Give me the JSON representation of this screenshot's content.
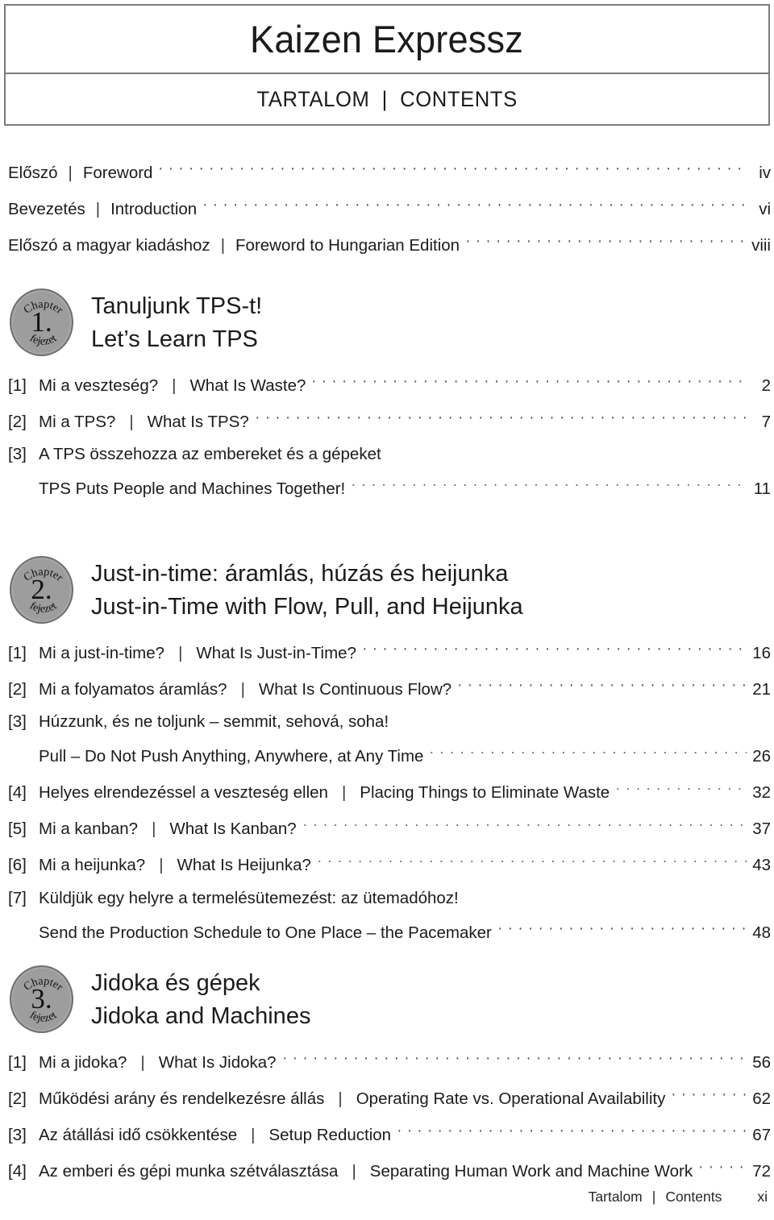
{
  "header": {
    "title": "Kaizen Expressz",
    "subtitle_hu": "TARTALOM",
    "subtitle_sep": "|",
    "subtitle_en": "CONTENTS"
  },
  "front_matter": [
    {
      "label_hu": "Előszó",
      "sep": "|",
      "label_en": "Foreword",
      "page": "iv"
    },
    {
      "label_hu": "Bevezetés",
      "sep": "|",
      "label_en": "Introduction",
      "page": "vi"
    },
    {
      "label_hu": "Előszó a magyar kiadáshoz",
      "sep": "|",
      "label_en": "Foreword to Hungarian Edition",
      "page": "viii"
    }
  ],
  "chapters": [
    {
      "badge": {
        "top_text": "Chapter",
        "number": "1.",
        "bottom_text": "fejezet"
      },
      "title_hu": "Tanuljunk TPS-t!",
      "title_en": "Let’s Learn TPS",
      "entries": [
        {
          "num": "[1]",
          "hu": "Mi a veszteség?",
          "sep": "|",
          "en": "What Is Waste?",
          "page": "2",
          "two_line": false
        },
        {
          "num": "[2]",
          "hu": "Mi a TPS?",
          "sep": "|",
          "en": "What Is TPS?",
          "page": "7",
          "two_line": false
        },
        {
          "num": "[3]",
          "hu": "A TPS összehozza az embereket és a gépeket",
          "sep": "",
          "en": "TPS Puts People and Machines Together!",
          "page": "11",
          "two_line": true
        }
      ]
    },
    {
      "badge": {
        "top_text": "Chapter",
        "number": "2.",
        "bottom_text": "fejezet"
      },
      "title_hu": "Just-in-time: áramlás, húzás és heijunka",
      "title_en": "Just-in-Time with Flow, Pull, and Heijunka",
      "entries": [
        {
          "num": "[1]",
          "hu": "Mi a just-in-time?",
          "sep": "|",
          "en": "What Is Just-in-Time?",
          "page": "16",
          "two_line": false
        },
        {
          "num": "[2]",
          "hu": "Mi a folyamatos áramlás?",
          "sep": "|",
          "en": "What Is Continuous Flow?",
          "page": "21",
          "two_line": false
        },
        {
          "num": "[3]",
          "hu": "Húzzunk, és ne toljunk – semmit, sehová, soha!",
          "sep": "",
          "en": "Pull – Do Not Push Anything, Anywhere, at Any Time",
          "page": "26",
          "two_line": true
        },
        {
          "num": "[4]",
          "hu": "Helyes elrendezéssel a veszteség ellen",
          "sep": "|",
          "en": "Placing Things to Eliminate Waste",
          "page": "32",
          "two_line": false
        },
        {
          "num": "[5]",
          "hu": "Mi a kanban?",
          "sep": "|",
          "en": "What Is Kanban?",
          "page": "37",
          "two_line": false
        },
        {
          "num": "[6]",
          "hu": "Mi a heijunka?",
          "sep": "|",
          "en": "What Is Heijunka?",
          "page": "43",
          "two_line": false
        },
        {
          "num": "[7]",
          "hu": "Küldjük egy helyre a termelésütemezést: az ütemadóhoz!",
          "sep": "",
          "en": "Send the Production Schedule to One Place – the Pacemaker",
          "page": "48",
          "two_line": true
        }
      ]
    },
    {
      "badge": {
        "top_text": "Chapter",
        "number": "3.",
        "bottom_text": "fejezet"
      },
      "title_hu": "Jidoka és gépek",
      "title_en": "Jidoka and Machines",
      "entries": [
        {
          "num": "[1]",
          "hu": "Mi a jidoka?",
          "sep": "|",
          "en": "What Is Jidoka?",
          "page": "56",
          "two_line": false
        },
        {
          "num": "[2]",
          "hu": "Működési arány és rendelkezésre állás",
          "sep": "|",
          "en": "Operating Rate vs. Operational Availability",
          "page": "62",
          "two_line": false
        },
        {
          "num": "[3]",
          "hu": "Az átállási idő csökkentése",
          "sep": "|",
          "en": "Setup Reduction",
          "page": "67",
          "two_line": false
        },
        {
          "num": "[4]",
          "hu": "Az emberi és gépi munka szétválasztása",
          "sep": "|",
          "en": "Separating Human Work and Machine Work",
          "page": "72",
          "two_line": false
        }
      ]
    }
  ],
  "footer": {
    "label_hu": "Tartalom",
    "sep": "|",
    "label_en": "Contents",
    "page": "xi"
  },
  "colors": {
    "badge_fill": "#9d9d9d",
    "badge_ring": "#6f6f6f",
    "border": "#7b7b7b",
    "text": "#1b1b1b"
  },
  "layout": {
    "chapter_tops": [
      358,
      690,
      1198
    ]
  }
}
